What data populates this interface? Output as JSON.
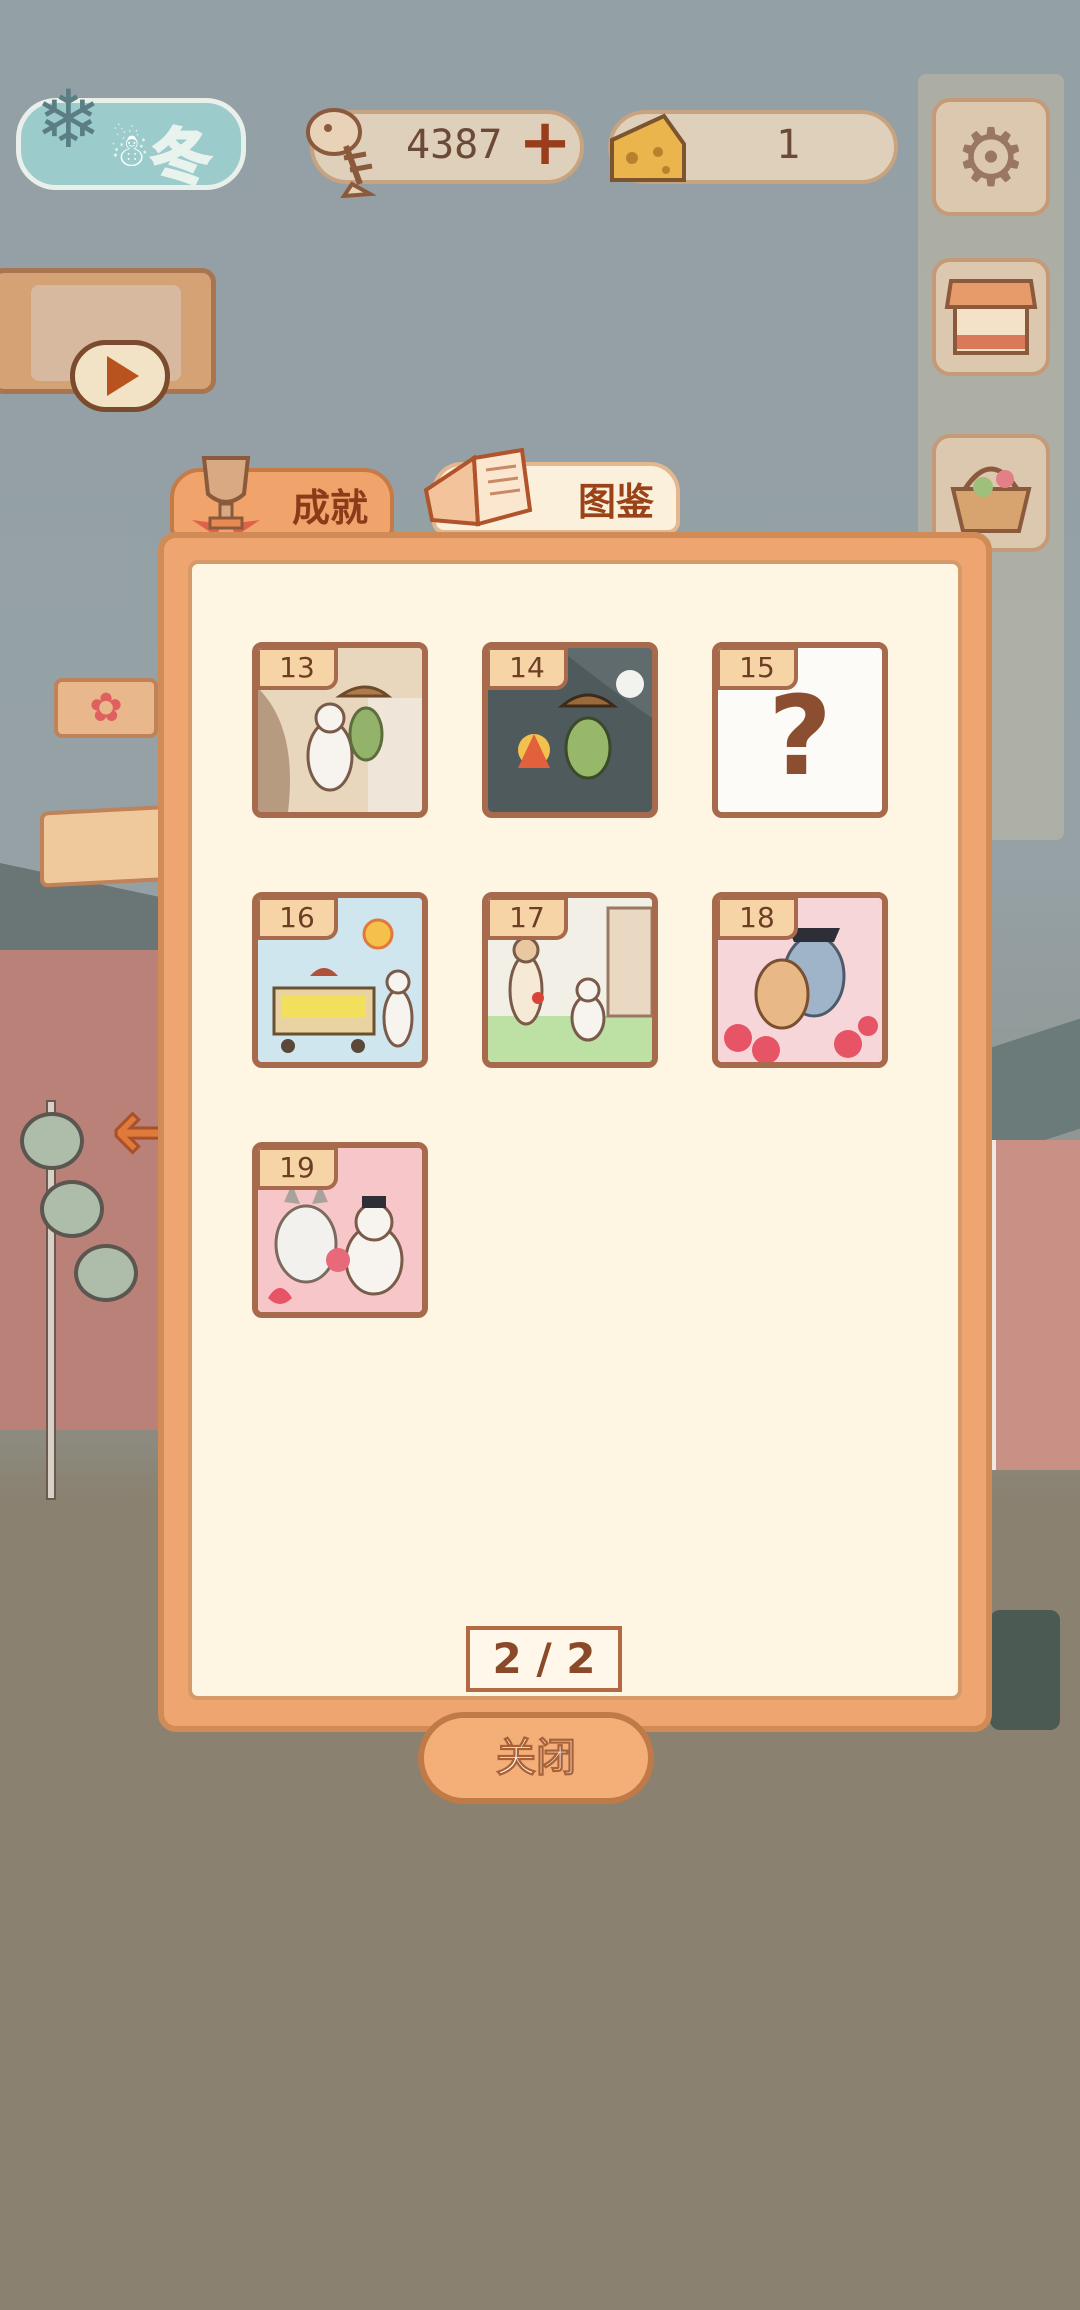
{
  "header": {
    "season_label": "冬",
    "fish_count": "4387",
    "cheese_count": "1",
    "icons": [
      "fish-bone-icon",
      "plus-icon",
      "cheese-icon",
      "gear-icon",
      "shop-stall-icon",
      "basket-icon"
    ]
  },
  "tabs": [
    {
      "label": "成就",
      "icon": "trophy-icon",
      "active": false
    },
    {
      "label": "图鉴",
      "icon": "book-icon",
      "active": true
    }
  ],
  "album": {
    "cards": [
      {
        "number": "13",
        "unlocked": true,
        "scene": "frog-cowboy-and-mouse"
      },
      {
        "number": "14",
        "unlocked": true,
        "scene": "frog-by-campfire"
      },
      {
        "number": "15",
        "unlocked": false,
        "scene": "locked",
        "placeholder": "?"
      },
      {
        "number": "16",
        "unlocked": true,
        "scene": "food-cart-sunny-day"
      },
      {
        "number": "17",
        "unlocked": true,
        "scene": "mice-in-garden"
      },
      {
        "number": "18",
        "unlocked": true,
        "scene": "cat-and-wolf-with-roses"
      },
      {
        "number": "19",
        "unlocked": true,
        "scene": "cat-and-mouse-with-bouquet"
      }
    ],
    "pager": "2 / 2"
  },
  "close_label": "关闭",
  "colors": {
    "panel": "#eea56f",
    "panel_inner": "#fef6e3",
    "card_border": "#a86a4d",
    "accent": "#9a4318"
  }
}
